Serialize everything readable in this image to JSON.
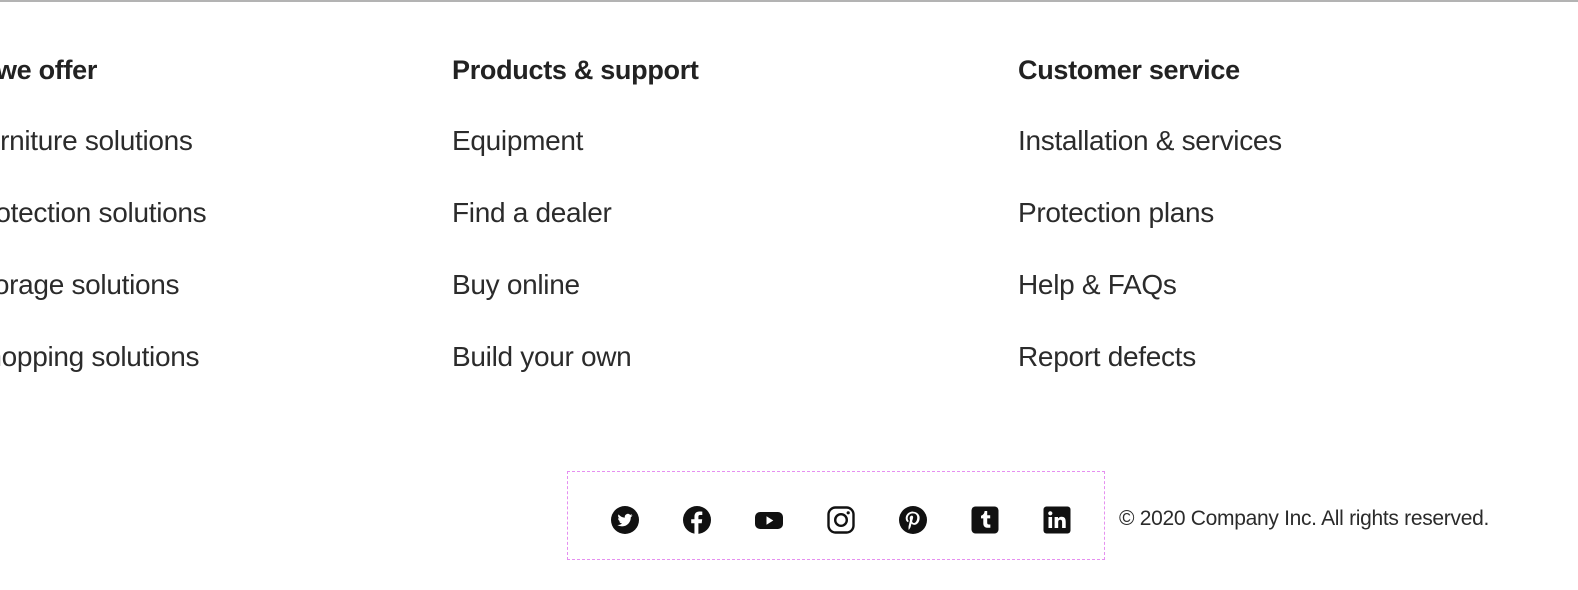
{
  "columns": [
    {
      "heading": "What we offer",
      "links": [
        "Furniture solutions",
        "Protection solutions",
        "Storage solutions",
        "Shopping solutions"
      ]
    },
    {
      "heading": "Products & support",
      "links": [
        "Equipment",
        "Find a dealer",
        "Buy online",
        "Build your own"
      ]
    },
    {
      "heading": "Customer service",
      "links": [
        "Installation & services",
        "Protection plans",
        "Help & FAQs",
        "Report defects"
      ]
    }
  ],
  "social": {
    "icons": [
      "twitter-icon",
      "facebook-icon",
      "youtube-icon",
      "instagram-icon",
      "pinterest-icon",
      "tumblr-icon",
      "linkedin-icon"
    ]
  },
  "footer": {
    "copyright": "© 2020 Company Inc. All rights reserved."
  },
  "colors": {
    "text": "#1f1f1f",
    "divider": "#b3b3b3",
    "highlight_border": "#e58ff0",
    "icon": "#111111"
  }
}
